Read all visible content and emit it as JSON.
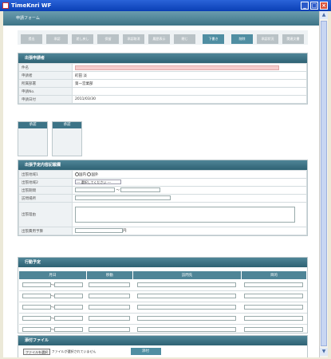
{
  "window": {
    "title": "TimeKnri WF",
    "minimize": "_",
    "maximize": "□",
    "close": "×"
  },
  "header": {
    "title": "申請フォーム"
  },
  "toolbar": {
    "buttons": [
      {
        "label": "提出",
        "active": true
      },
      {
        "label": "承認",
        "active": false
      },
      {
        "label": "差し戻し",
        "active": false
      },
      {
        "label": "保留",
        "active": false
      },
      {
        "label": "承認取消",
        "active": false
      },
      {
        "label": "履歴表示",
        "active": false
      },
      {
        "label": "閉じ",
        "active": false
      },
      {
        "label": "下書き",
        "active": true
      },
      {
        "label": "削除",
        "active": true
      },
      {
        "label": "承認状況",
        "active": false
      },
      {
        "label": "関連文書",
        "active": false
      }
    ]
  },
  "applicant": {
    "title": "出張申請者",
    "rows": [
      {
        "label": "件名",
        "value": ""
      },
      {
        "label": "申請者",
        "value": "町田 淡"
      },
      {
        "label": "所属部署",
        "value": "第一営業部"
      },
      {
        "label": "申請No.",
        "value": ""
      },
      {
        "label": "申請日付",
        "value": "2011/03/30"
      }
    ]
  },
  "approvals": [
    "承認",
    "承認"
  ],
  "trip": {
    "title": "出張予定内容記載欄",
    "destination1_label": "出張地域1",
    "radio_domestic": "国内",
    "radio_overseas": "国外",
    "destination2_label": "出張地域2",
    "destination2_select": "--- 選択してください ---",
    "period_label": "出張期間",
    "tilde": "〜",
    "visit_label": "訪問場所",
    "reason_label": "出張理由",
    "budget_label": "出張費用予算",
    "yen": "円"
  },
  "schedule": {
    "title": "行動予定",
    "columns": [
      "月日",
      "移動",
      "訪問先",
      "目的"
    ],
    "tilde": "〜",
    "row_count": 5
  },
  "attachment": {
    "title": "添付ファイル",
    "choose_label": "ファイルを選択",
    "no_file_text": "ファイルが選択されていません",
    "upload_label": "添付"
  }
}
